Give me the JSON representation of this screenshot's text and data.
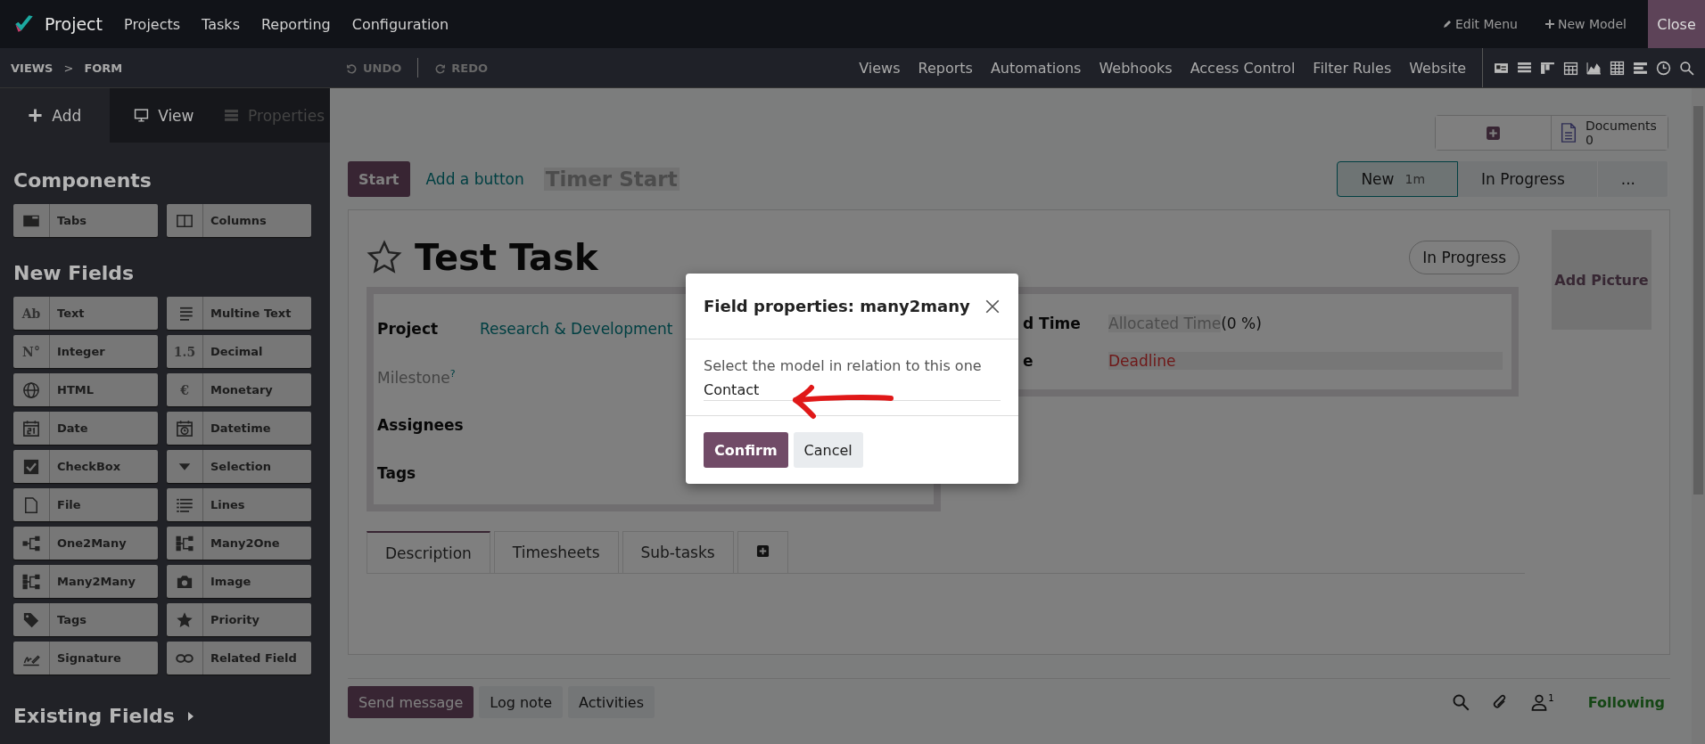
{
  "app": {
    "name": "Project",
    "menu": [
      "Projects",
      "Tasks",
      "Reporting",
      "Configuration"
    ],
    "actions": [
      "Edit Menu",
      "New Model"
    ],
    "close": "Close"
  },
  "studio_bar": {
    "breadcrumb": [
      "VIEWS",
      "FORM"
    ],
    "separator": ">",
    "undo": "UNDO",
    "redo": "REDO",
    "links": [
      "Views",
      "Reports",
      "Automations",
      "Webhooks",
      "Access Control",
      "Filter Rules",
      "Website"
    ]
  },
  "sidebar": {
    "tabs": [
      {
        "label": "Add",
        "kind": "add",
        "selected": true,
        "disabled": false
      },
      {
        "label": "View",
        "kind": "view",
        "selected": false,
        "disabled": false
      },
      {
        "label": "Properties",
        "kind": "properties",
        "selected": false,
        "disabled": true
      }
    ],
    "components": {
      "heading": "Components",
      "items": [
        {
          "label": "Tabs",
          "kind": "tabs"
        },
        {
          "label": "Columns",
          "kind": "columns"
        }
      ]
    },
    "new_fields": {
      "heading": "New Fields",
      "items": [
        {
          "label": "Text",
          "kind": "glyph",
          "glyph": "Ab"
        },
        {
          "label": "Multine Text",
          "kind": "multiline"
        },
        {
          "label": "Integer",
          "kind": "glyph",
          "glyph": "N°"
        },
        {
          "label": "Decimal",
          "kind": "glyph",
          "glyph": "1.5"
        },
        {
          "label": "HTML",
          "kind": "globe"
        },
        {
          "label": "Monetary",
          "kind": "glyph",
          "glyph": "€"
        },
        {
          "label": "Date",
          "kind": "date"
        },
        {
          "label": "Datetime",
          "kind": "datetime"
        },
        {
          "label": "CheckBox",
          "kind": "checkbox"
        },
        {
          "label": "Selection",
          "kind": "selection"
        },
        {
          "label": "File",
          "kind": "file"
        },
        {
          "label": "Lines",
          "kind": "lines"
        },
        {
          "label": "One2Many",
          "kind": "one2many"
        },
        {
          "label": "Many2One",
          "kind": "many2one"
        },
        {
          "label": "Many2Many",
          "kind": "many2many"
        },
        {
          "label": "Image",
          "kind": "image"
        },
        {
          "label": "Tags",
          "kind": "tags"
        },
        {
          "label": "Priority",
          "kind": "priority"
        },
        {
          "label": "Signature",
          "kind": "signature"
        },
        {
          "label": "Related Field",
          "kind": "related"
        }
      ]
    },
    "existing_fields": {
      "heading": "Existing Fields",
      "expanded": false
    }
  },
  "form": {
    "header_buttons": {
      "start": "Start",
      "add_button": "Add a button",
      "timer": "Timer Start"
    },
    "smart_buttons": [
      {
        "kind": "add"
      },
      {
        "kind": "documents",
        "label": "Documents",
        "count": "0"
      }
    ],
    "stages": [
      {
        "label": "New",
        "duration": "1m",
        "selected": true
      },
      {
        "label": "In Progress",
        "selected": false
      },
      {
        "label": "...",
        "selected": false
      }
    ],
    "title": "Test Task",
    "starred": false,
    "state_badge": "In Progress",
    "add_picture": "Add Picture",
    "left_fields": [
      {
        "label": "Project",
        "value": "Research & Development",
        "muted": false
      },
      {
        "label": "Milestone",
        "help": "?",
        "muted": true
      },
      {
        "label": "Assignees",
        "muted": false
      },
      {
        "label": "Tags",
        "muted": false
      }
    ],
    "right_fields": [
      {
        "label": "d Time",
        "placeholder": "Allocated Time",
        "suffix": "(0 %)",
        "kind": "time"
      },
      {
        "label": "e",
        "placeholder": "Deadline",
        "kind": "deadline"
      }
    ],
    "tabs": [
      {
        "label": "Description",
        "selected": true
      },
      {
        "label": "Timesheets",
        "selected": false
      },
      {
        "label": "Sub-tasks",
        "selected": false
      }
    ]
  },
  "chatter": {
    "buttons": [
      {
        "label": "Send message",
        "primary": true
      },
      {
        "label": "Log note",
        "primary": false
      },
      {
        "label": "Activities",
        "primary": false
      }
    ],
    "follower_count": "1",
    "following": "Following"
  },
  "dialog": {
    "title": "Field properties: many2many",
    "prompt": "Select the model in relation to this one",
    "value": "Contact",
    "confirm": "Confirm",
    "cancel": "Cancel"
  }
}
